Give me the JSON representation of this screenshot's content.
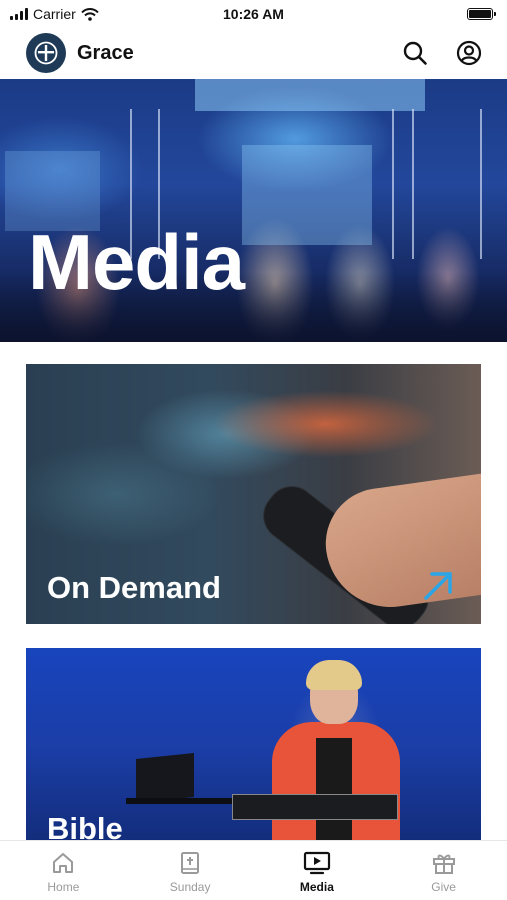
{
  "status_bar": {
    "carrier": "Carrier",
    "time": "10:26 AM"
  },
  "header": {
    "brand": "Grace",
    "icons": {
      "logo": "grace-logo-icon",
      "search": "search-icon",
      "profile": "profile-icon"
    }
  },
  "hero": {
    "title": "Media"
  },
  "cards": [
    {
      "title": "On Demand",
      "icon": "arrow-up-right-icon",
      "accent": "#2aa6e8"
    },
    {
      "title": "Bible"
    }
  ],
  "tabs": [
    {
      "label": "Home",
      "icon": "home-icon"
    },
    {
      "label": "Sunday",
      "icon": "bible-icon"
    },
    {
      "label": "Media",
      "icon": "tv-play-icon",
      "active": true
    },
    {
      "label": "Give",
      "icon": "gift-icon"
    }
  ]
}
